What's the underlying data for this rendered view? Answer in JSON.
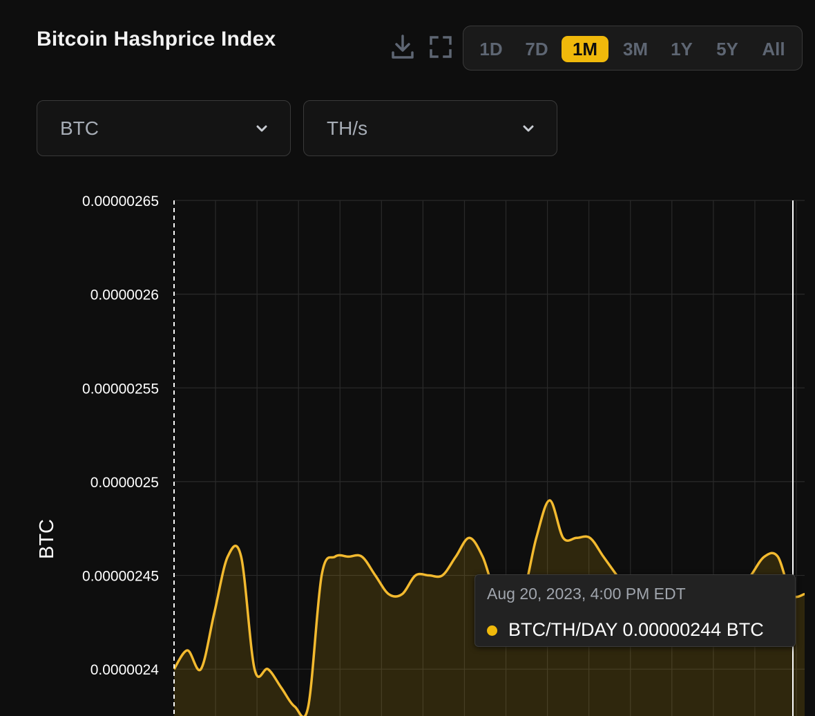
{
  "header": {
    "title": "Bitcoin Hashprice Index",
    "download_icon": "download-icon",
    "fullscreen_icon": "fullscreen-icon"
  },
  "range_tabs": [
    {
      "label": "1D",
      "active": false
    },
    {
      "label": "7D",
      "active": false
    },
    {
      "label": "1M",
      "active": true
    },
    {
      "label": "3M",
      "active": false
    },
    {
      "label": "1Y",
      "active": false
    },
    {
      "label": "5Y",
      "active": false
    },
    {
      "label": "All",
      "active": false
    }
  ],
  "selectors": {
    "currency": "BTC",
    "hash_unit": "TH/s"
  },
  "tooltip": {
    "date": "Aug 20, 2023, 4:00 PM EDT",
    "series": "BTC/TH/DAY",
    "value": "0.00000244 BTC"
  },
  "colors": {
    "accent": "#f0b90b",
    "background": "#0e0e0e",
    "line": "#f3ba2f"
  },
  "chart_data": {
    "type": "area",
    "ylabel": "BTC",
    "ylim": [
      2.375e-06,
      2.65e-06
    ],
    "yticks": [
      {
        "value": 2.65e-06,
        "label": "0.00000265"
      },
      {
        "value": 2.6e-06,
        "label": "0.0000026"
      },
      {
        "value": 2.55e-06,
        "label": "0.00000255"
      },
      {
        "value": 2.5e-06,
        "label": "0.0000025"
      },
      {
        "value": 2.45e-06,
        "label": "0.00000245"
      },
      {
        "value": 2.4e-06,
        "label": "0.0000024"
      }
    ],
    "grid": true,
    "series": [
      {
        "name": "BTC/TH/DAY",
        "values": [
          2.4e-06,
          2.41e-06,
          2.4e-06,
          2.43e-06,
          2.46e-06,
          2.46e-06,
          2.4e-06,
          2.4e-06,
          2.39e-06,
          2.38e-06,
          2.38e-06,
          2.45e-06,
          2.46e-06,
          2.46e-06,
          2.46e-06,
          2.45e-06,
          2.44e-06,
          2.44e-06,
          2.45e-06,
          2.45e-06,
          2.45e-06,
          2.46e-06,
          2.47e-06,
          2.46e-06,
          2.44e-06,
          2.44e-06,
          2.44e-06,
          2.47e-06,
          2.49e-06,
          2.47e-06,
          2.47e-06,
          2.47e-06,
          2.46e-06,
          2.45e-06,
          2.44e-06,
          2.44e-06,
          2.44e-06,
          2.44e-06,
          2.44e-06,
          2.44e-06,
          2.44e-06,
          2.44e-06,
          2.44e-06,
          2.45e-06,
          2.46e-06,
          2.46e-06,
          2.44e-06,
          2.44e-06
        ]
      }
    ]
  }
}
